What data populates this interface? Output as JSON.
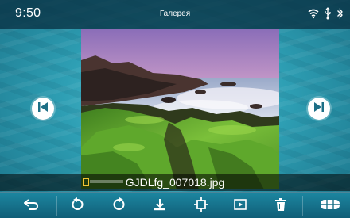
{
  "status_bar": {
    "time": "9:50",
    "app_title": "Галерея",
    "icons": [
      "wifi-icon",
      "usb-icon",
      "bluetooth-icon"
    ]
  },
  "viewer": {
    "filename": "GJDLfg_007018.jpg",
    "prev_icon": "skip-previous-icon",
    "next_icon": "skip-next-icon"
  },
  "toolbar": {
    "buttons": [
      "back-icon",
      "rotate-left-icon",
      "rotate-right-icon",
      "download-icon",
      "crop-icon",
      "slideshow-icon",
      "delete-icon",
      "grid-icon"
    ]
  },
  "colors": {
    "accent": "#1c86a0",
    "status_bar": "#093244",
    "icon": "#ffffff"
  }
}
